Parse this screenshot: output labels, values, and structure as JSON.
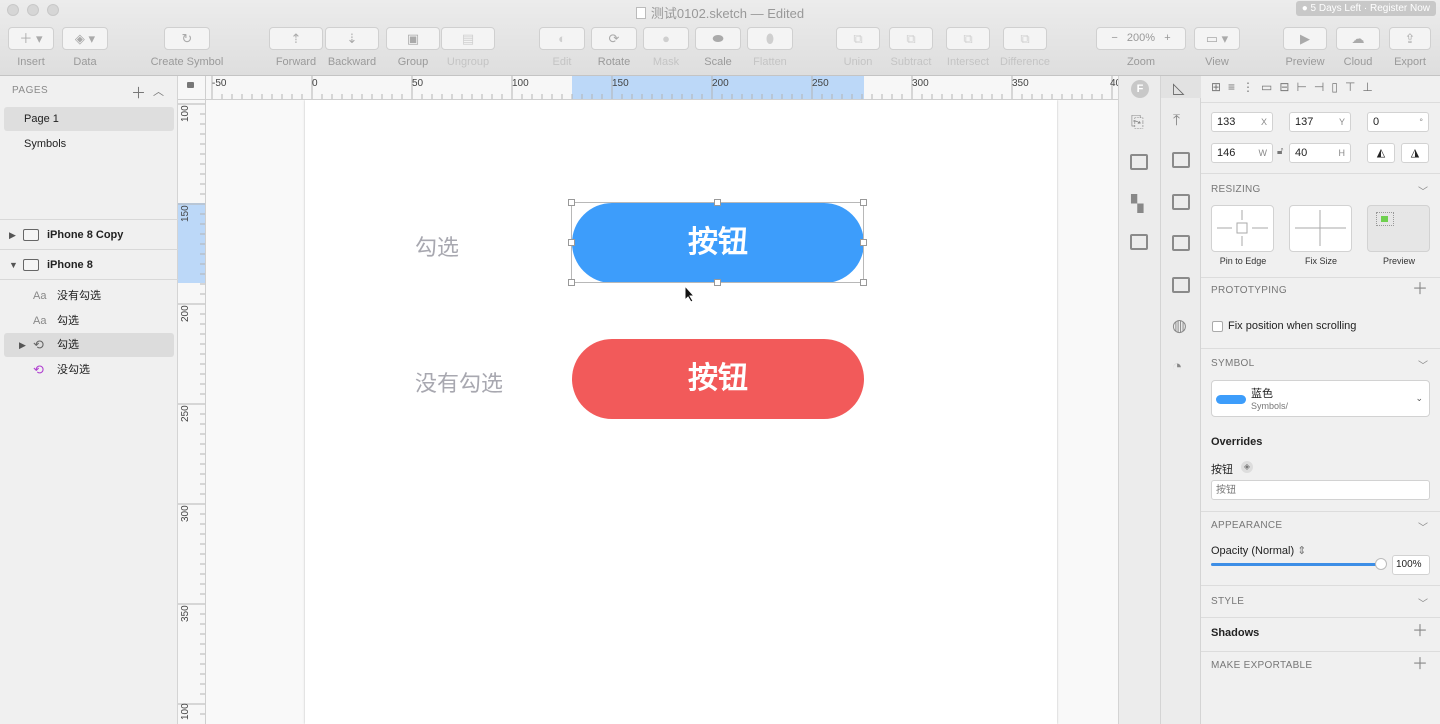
{
  "window": {
    "title": "测试0102.sketch — Edited",
    "trial_badge": "● 5 Days Left · Register Now"
  },
  "toolbar": {
    "insert": "Insert",
    "data": "Data",
    "create_symbol": "Create Symbol",
    "forward": "Forward",
    "backward": "Backward",
    "group": "Group",
    "ungroup": "Ungroup",
    "edit": "Edit",
    "rotate": "Rotate",
    "mask": "Mask",
    "scale": "Scale",
    "flatten": "Flatten",
    "union": "Union",
    "subtract": "Subtract",
    "intersect": "Intersect",
    "difference": "Difference",
    "zoom_label": "Zoom",
    "zoom_value": "200%",
    "zoom_minus": "−",
    "zoom_plus": "+",
    "view": "View",
    "preview": "Preview",
    "cloud": "Cloud",
    "export": "Export"
  },
  "pages": {
    "header": "PAGES",
    "items": [
      {
        "label": "Page 1",
        "selected": true
      },
      {
        "label": "Symbols",
        "selected": false
      }
    ]
  },
  "layers": {
    "artboards": [
      {
        "label": "iPhone 8 Copy"
      },
      {
        "label": "iPhone 8"
      }
    ],
    "children": [
      {
        "icon": "Aa",
        "label": "没有勾选"
      },
      {
        "icon": "Aa",
        "label": "勾选"
      },
      {
        "icon": "symbol-instance-icon",
        "label": "勾选"
      },
      {
        "icon": "symbol-instance-icon",
        "label": "没勾选"
      }
    ]
  },
  "rulers": {
    "top_labels": [
      "-50",
      "0",
      "50",
      "100",
      "150",
      "200",
      "250",
      "300",
      "350",
      "40"
    ],
    "left_labels": [
      "100",
      "150",
      "200",
      "250",
      "300",
      "350",
      "100"
    ]
  },
  "canvas": {
    "label_checked": "勾选",
    "label_unchecked": "没有勾选",
    "button_blue_text": "按钮",
    "button_red_text": "按钮",
    "blue": "#3d9dfb",
    "red": "#f25a5a"
  },
  "inspector": {
    "x": "133",
    "x_suffix": "X",
    "y": "137",
    "y_suffix": "Y",
    "rotation": "0",
    "rotation_suffix": "°",
    "w": "146",
    "w_suffix": "W",
    "h": "40",
    "h_suffix": "H",
    "resizing": "RESIZING",
    "pin_to_edge": "Pin to Edge",
    "fix_size": "Fix Size",
    "preview": "Preview",
    "prototyping": "PROTOTYPING",
    "fix_position": "Fix position when scrolling",
    "symbol": "SYMBOL",
    "symbol_name": "蓝色",
    "symbol_path": "Symbols/",
    "overrides": "Overrides",
    "override_label": "按钮",
    "override_placeholder": "按钮",
    "appearance": "APPEARANCE",
    "opacity_label": "Opacity (Normal)",
    "opacity_value": "100%",
    "opacity_fraction": 1.0,
    "style": "STYLE",
    "shadows": "Shadows",
    "make_exportable": "MAKE EXPORTABLE"
  }
}
